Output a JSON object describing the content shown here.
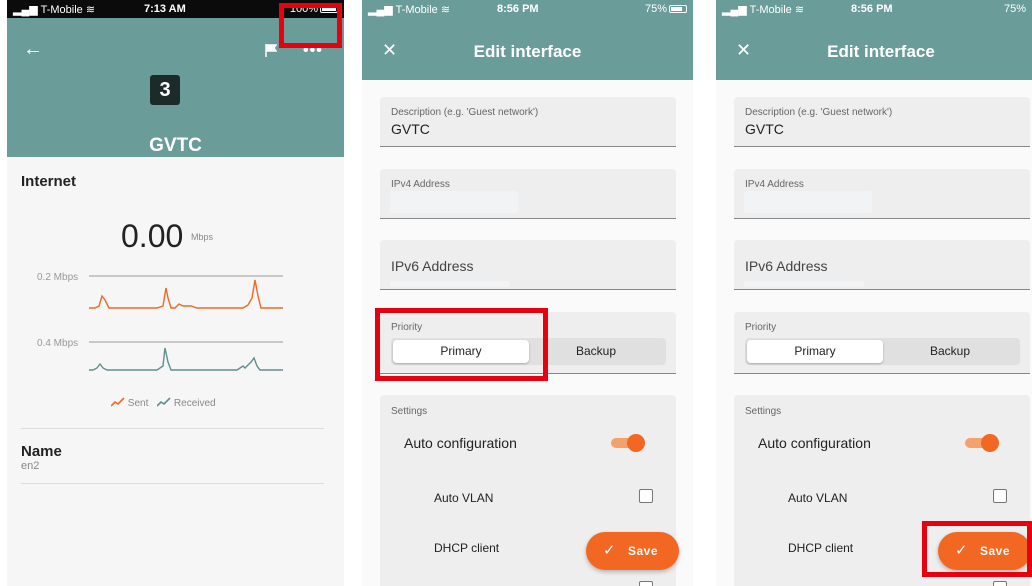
{
  "panel1": {
    "status": {
      "carrier": "T-Mobile",
      "time": "7:13 AM",
      "battery": "100%",
      "battery_level": 1.0
    },
    "device_badge": "3",
    "device_name": "GVTC",
    "section_title": "Internet",
    "speed_value": "0.00",
    "speed_unit": "Mbps",
    "sent_axis_label": "0.2 Mbps",
    "received_axis_label": "0.4 Mbps",
    "legend": {
      "sent": "Sent",
      "received": "Received"
    },
    "name_label": "Name",
    "name_value": "en2",
    "colors": {
      "header": "#6a9c99",
      "sent": "#f26722",
      "received": "#5f8f8c",
      "highlight": "#e8000e"
    }
  },
  "panel2": {
    "status": {
      "carrier": "T-Mobile",
      "time": "8:56 PM",
      "battery": "75%",
      "battery_level": 0.75
    },
    "title": "Edit interface",
    "description_label": "Description (e.g. 'Guest network')",
    "description_value": "GVTC",
    "ipv4_label": "IPv4 Address",
    "ipv6_label": "IPv6 Address",
    "priority_label": "Priority",
    "priority_options": [
      "Primary",
      "Backup"
    ],
    "settings_label": "Settings",
    "auto_configuration": "Auto configuration",
    "auto_vlan": "Auto VLAN",
    "dhcp_client": "DHCP client",
    "save": "Save"
  },
  "panel3": {
    "status": {
      "carrier": "T-Mobile",
      "time": "8:56 PM",
      "battery": "75%",
      "battery_level": 0.75
    },
    "title": "Edit interface",
    "description_label": "Description (e.g. 'Guest network')",
    "description_value": "GVTC",
    "ipv4_label": "IPv4 Address",
    "ipv6_label": "IPv6 Address",
    "priority_label": "Priority",
    "priority_options": [
      "Primary",
      "Backup"
    ],
    "settings_label": "Settings",
    "auto_configuration": "Auto configuration",
    "auto_vlan": "Auto VLAN",
    "dhcp_client": "DHCP client",
    "save": "Save"
  }
}
